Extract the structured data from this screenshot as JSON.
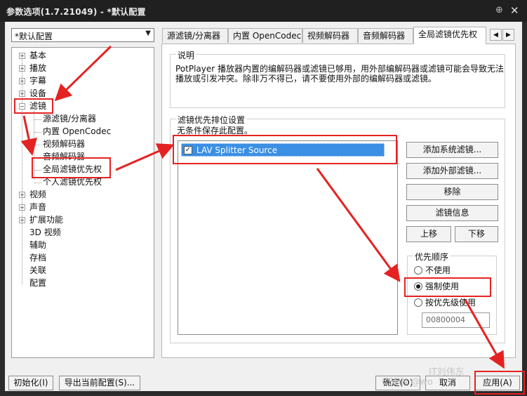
{
  "window": {
    "title": "参数选项(1.7.21049) - *默认配置",
    "pin_icon": "pin-icon",
    "close_icon": "close-icon"
  },
  "profile_dropdown": {
    "value": "*默认配置"
  },
  "tree": {
    "basic": "基本",
    "playback": "播放",
    "subtitle": "字幕",
    "device": "设备",
    "filter": "滤镜",
    "filter_children": [
      "源滤镜/分离器",
      "内置 OpenCodec",
      "视频解码器",
      "音频解码器",
      "全局滤镜优先权",
      "个人滤镜优先权"
    ],
    "video": "视频",
    "audio": "声音",
    "extension": "扩展功能",
    "video3d": "3D 视频",
    "assist": "辅助",
    "archive": "存档",
    "association": "关联",
    "config": "配置"
  },
  "tabs": [
    "源滤镜/分离器",
    "内置 OpenCodec",
    "视频解码器",
    "音频解码器",
    "全局滤镜优先权"
  ],
  "active_tab": 4,
  "description": {
    "legend": "说明",
    "line1": "PotPlayer 播放器内置的编解码器或滤镜已够用，用外部编解码器或滤镜可能会导致无法",
    "line2": "播放或引发冲突。除非万不得已，请不要使用外部的编解码器或滤镜。"
  },
  "priority": {
    "legend": "滤镜优先排位设置",
    "note": "无条件保存此配置。",
    "list": [
      {
        "label": "LAV Splitter Source",
        "checked": true
      }
    ],
    "buttons": {
      "add_system": "添加系统滤镜...",
      "add_external": "添加外部滤镜...",
      "remove": "移除",
      "info": "滤镜信息",
      "up": "上移",
      "down": "下移"
    },
    "order": {
      "legend": "优先顺序",
      "options": [
        "不使用",
        "强制使用",
        "按优先级使用"
      ],
      "selected": 1,
      "priority_value": "00800004"
    }
  },
  "bottom": {
    "init": "初始化(I)",
    "export": "导出当前配置(S)...",
    "ok": "确定(O)",
    "cancel": "取消",
    "apply": "应用(A)"
  },
  "watermark": {
    "brand": "IT刘伟东",
    "csdn": "CSDN @wo"
  },
  "colors": {
    "annotation_red": "#e52222",
    "selection_blue": "#3b8fe4",
    "titlebar": "#202020"
  }
}
